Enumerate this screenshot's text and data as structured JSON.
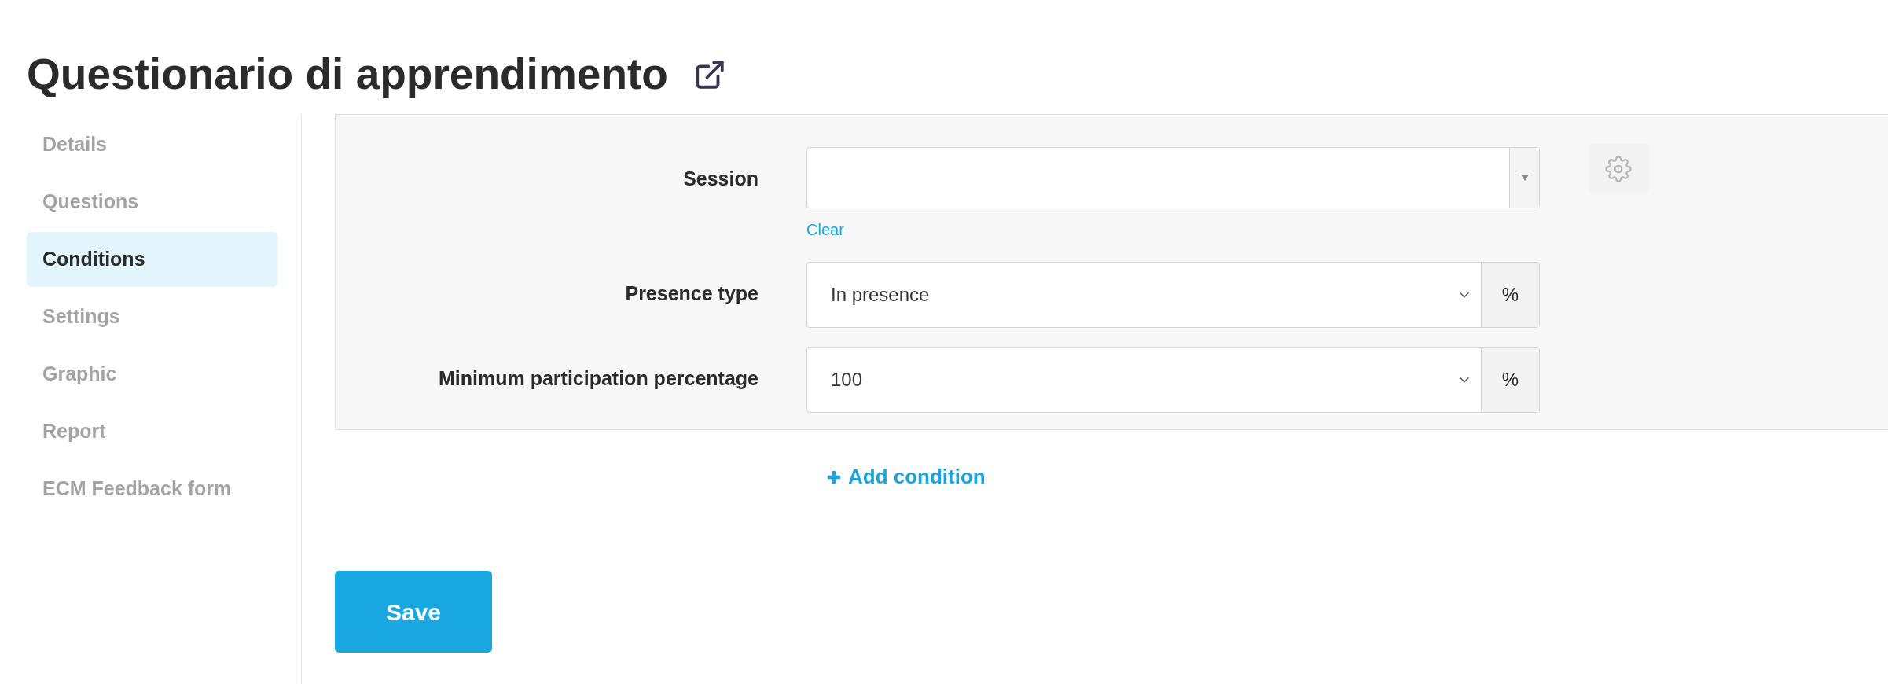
{
  "title": "Questionario di apprendimento",
  "sidebar": {
    "items": [
      {
        "label": "Details",
        "selected": false
      },
      {
        "label": "Questions",
        "selected": false
      },
      {
        "label": "Conditions",
        "selected": true
      },
      {
        "label": "Settings",
        "selected": false
      },
      {
        "label": "Graphic",
        "selected": false
      },
      {
        "label": "Report",
        "selected": false
      },
      {
        "label": "ECM Feedback form",
        "selected": false
      }
    ]
  },
  "condition": {
    "fields": [
      {
        "kind": "combo",
        "label": "Session",
        "link": "Clear"
      },
      {
        "kind": "select",
        "label": "Presence type",
        "value": "In presence",
        "addon": "%"
      },
      {
        "kind": "select",
        "label": "Minimum participation percentage",
        "value": "100",
        "addon": "%"
      }
    ]
  },
  "add_condition": "Add condition",
  "save_button": "Save"
}
